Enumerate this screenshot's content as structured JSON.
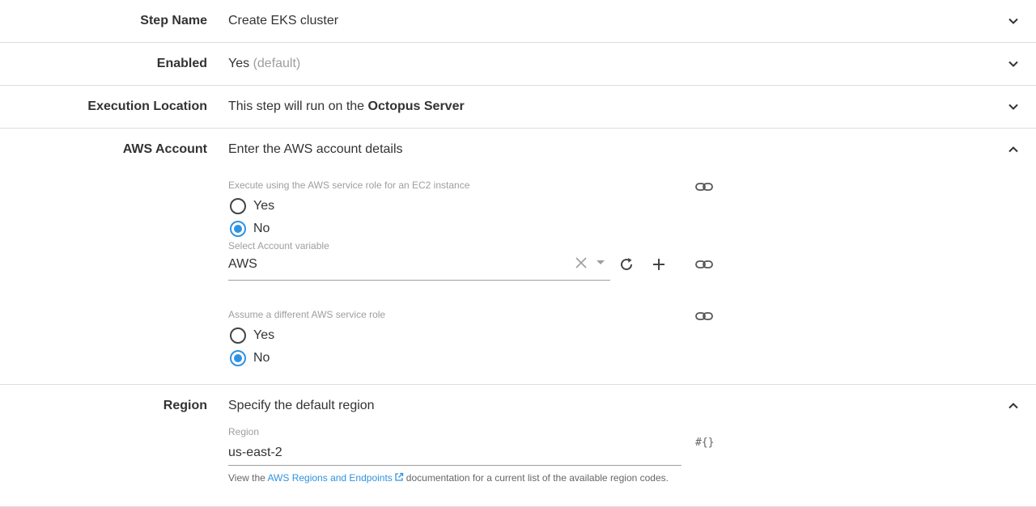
{
  "sections": {
    "step_name": {
      "label": "Step Name",
      "summary": "Create EKS cluster"
    },
    "enabled": {
      "label": "Enabled",
      "summary": "Yes",
      "summary_muted": "(default)"
    },
    "execution_location": {
      "label": "Execution Location",
      "summary_prefix": "This step will run on the",
      "summary_bold": "Octopus Server"
    },
    "aws_account": {
      "label": "AWS Account",
      "summary": "Enter the AWS account details",
      "ec2_role": {
        "label": "Execute using the AWS service role for an EC2 instance",
        "options": [
          "Yes",
          "No"
        ],
        "selected": "No"
      },
      "account_variable": {
        "label": "Select Account variable",
        "value": "AWS"
      },
      "assume_role": {
        "label": "Assume a different AWS service role",
        "options": [
          "Yes",
          "No"
        ],
        "selected": "No"
      }
    },
    "region": {
      "label": "Region",
      "summary": "Specify the default region",
      "field_label": "Region",
      "value": "us-east-2",
      "hint_prefix": "View the",
      "hint_link": "AWS Regions and Endpoints",
      "hint_suffix": "documentation for a current list of the available region codes.",
      "binding_label": "#{}"
    }
  },
  "colors": {
    "accent": "#2f93e0",
    "text": "#333333",
    "muted": "#9e9e9e",
    "divider": "#dedede"
  }
}
